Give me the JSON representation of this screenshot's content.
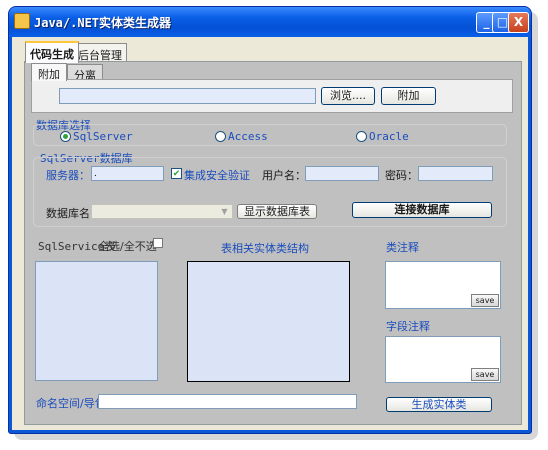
{
  "window": {
    "title": "Java/.NET实体类生成器",
    "minimize": "_",
    "maximize": "□",
    "close": "X"
  },
  "tabs": [
    {
      "label": "代码生成"
    },
    {
      "label": "后台管理"
    }
  ],
  "subtabs": [
    {
      "label": "附加"
    },
    {
      "label": "分离"
    }
  ],
  "attach": {
    "path_value": "",
    "browse_label": "浏览....",
    "attach_label": "附加"
  },
  "db_select": {
    "legend": "数据库选择",
    "options": [
      {
        "label": "SqlServer",
        "selected": true
      },
      {
        "label": "Access",
        "selected": false
      },
      {
        "label": "Oracle",
        "selected": false
      }
    ]
  },
  "sqlserver": {
    "legend": "SqlServer数据库",
    "server_label": "服务器：",
    "server_value": ".",
    "integrated_label": "集成安全验证",
    "integrated_checked": true,
    "username_label": "用户名：",
    "username_value": "",
    "password_label": "密码：",
    "password_value": "",
    "dbname_label": "数据库名：",
    "dbname_value": "",
    "show_db_label": "显示数据库表",
    "connect_label": "连接数据库"
  },
  "tables": {
    "header": "SqlService表",
    "select_all_label": "全选/全不选",
    "select_all_checked": false
  },
  "structure": {
    "header": "表相关实体类结构"
  },
  "class_comment": {
    "header": "类注释",
    "save_label": "save"
  },
  "field_comment": {
    "header": "字段注释",
    "save_label": "save"
  },
  "namespace": {
    "label": "命名空间/导包",
    "value": ""
  },
  "generate_label": "生成实体类",
  "colors": {
    "title_bar": "#0a5fe6",
    "panel": "#c0c0c0",
    "input_bg": "#e3ebfa",
    "label_blue": "#1a4dbd"
  }
}
